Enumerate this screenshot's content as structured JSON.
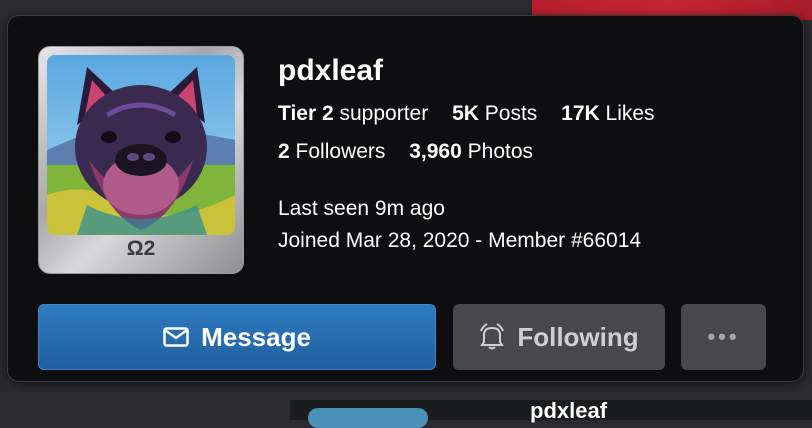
{
  "profile": {
    "username": "pdxleaf",
    "badge": "Ω2",
    "tier_label": "Tier 2",
    "tier_suffix": "supporter",
    "posts_count": "5K",
    "posts_label": "Posts",
    "likes_count": "17K",
    "likes_label": "Likes",
    "followers_count": "2",
    "followers_label": "Followers",
    "photos_count": "3,960",
    "photos_label": "Photos",
    "last_seen": "Last seen 9m ago",
    "joined": "Joined Mar 28, 2020 - Member #66014"
  },
  "actions": {
    "message_label": "Message",
    "following_label": "Following",
    "more_label": "•••"
  },
  "background": {
    "peek_text": "pdxleaf"
  },
  "colors": {
    "card_bg": "#0e0e10",
    "message_blue": "#2f7bc0",
    "following_gray": "#48484c"
  }
}
